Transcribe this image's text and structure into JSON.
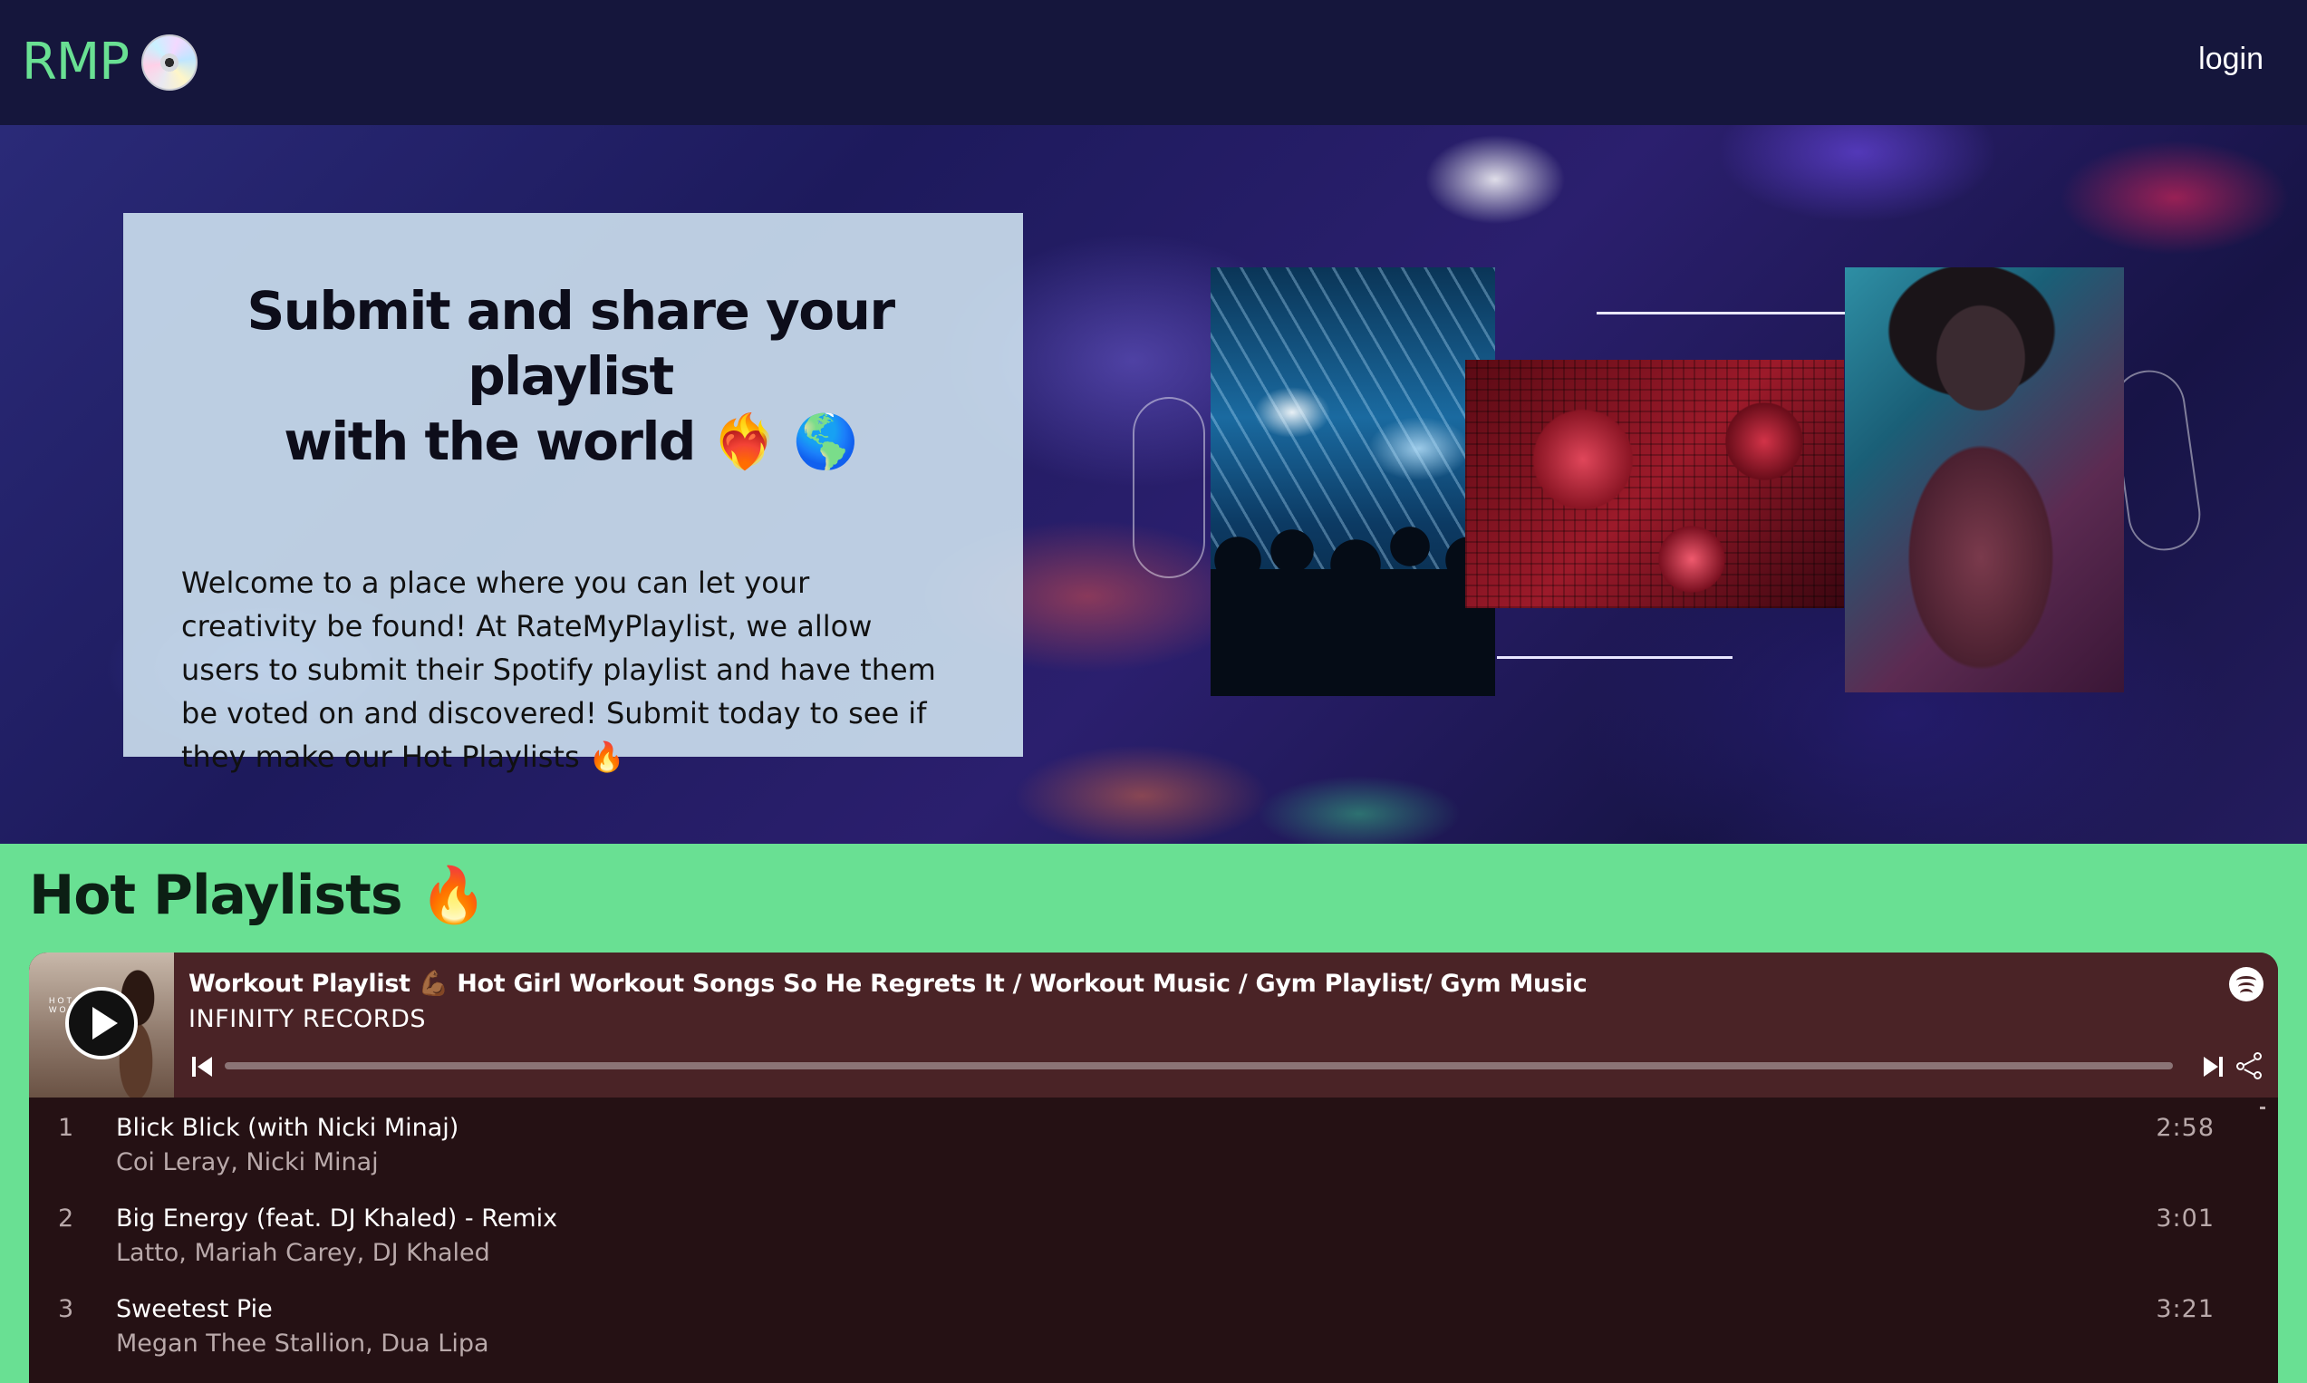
{
  "nav": {
    "logo_text": "RMP",
    "logo_icon": "cd-icon",
    "login_label": "login"
  },
  "hero": {
    "title_line1": "Submit and share your playlist",
    "title_line2": "with the world ❤️‍🔥 🌎",
    "body": "Welcome to a place where you can let your creativity be found! At RateMyPlaylist, we allow users to submit their Spotify playlist and have them be voted on and discovered! Submit today to see if they make our Hot Playlists 🔥"
  },
  "hot": {
    "title": "Hot Playlists 🔥"
  },
  "player": {
    "title": "Workout Playlist 💪🏾 Hot Girl Workout Songs So He Regrets It / Workout Music / Gym Playlist/ Gym Music",
    "owner": "INFINITY RECORDS",
    "cover_caption": "HOT GIRL WORKOUT",
    "progress": 0,
    "tracks": [
      {
        "num": "1",
        "name": "Blick Blick (with Nicki Minaj)",
        "artist": "Coi Leray, Nicki Minaj",
        "duration": "2:58"
      },
      {
        "num": "2",
        "name": "Big Energy (feat. DJ Khaled) - Remix",
        "artist": "Latto, Mariah Carey, DJ Khaled",
        "duration": "3:01"
      },
      {
        "num": "3",
        "name": "Sweetest Pie",
        "artist": "Megan Thee Stallion, Dua Lipa",
        "duration": "3:21"
      }
    ]
  },
  "colors": {
    "nav_bg": "#15163c",
    "brand_green": "#69e093",
    "player_head": "#4a2326",
    "player_body": "#251114"
  }
}
